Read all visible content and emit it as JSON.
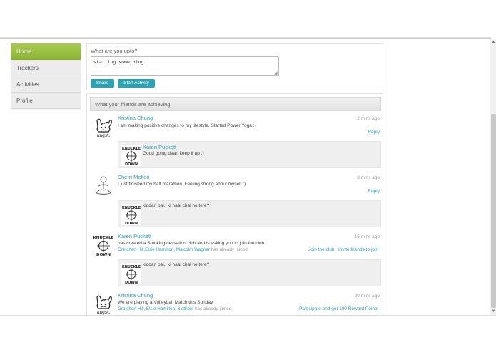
{
  "sidebar": {
    "items": [
      {
        "label": "Home",
        "active": true
      },
      {
        "label": "Trackers",
        "active": false
      },
      {
        "label": "Activities",
        "active": false
      },
      {
        "label": "Profile",
        "active": false
      }
    ]
  },
  "composer": {
    "label": "What are you upto?",
    "input_value": "starting something",
    "share_label": "Share",
    "start_activity_label": "Start Activity"
  },
  "feed": {
    "title": "What your friends are achieving",
    "posts": [
      {
        "name": "Kristina Chung",
        "time": "2 mins ago",
        "text": "I am making positive changes to my lifestyle. Started Power Yoga :)",
        "avatar": "angst-bunny-avatar",
        "action": "Reply",
        "comment": {
          "name": "Karen Puckett",
          "text": "Good going dear, keep it up :)",
          "avatar": "knuckle-down-avatar"
        }
      },
      {
        "name": "Sherri Melton",
        "time": "8 mins ago",
        "text": "I just finished my half marathon. Feeling strong about myself :)",
        "avatar": "meditating-figure-avatar",
        "action": "Reply",
        "comment": {
          "text": "kiddan bai.. ki haal chal ne tere?",
          "avatar": "knuckle-down-avatar"
        }
      },
      {
        "name": "Karen Puckett",
        "time": "15 mins ago",
        "text_before": "has created a ",
        "text_highlight": "Smoking cessation club",
        "text_after": " and is asking you to join the club.",
        "friends_links": "Gretchen Hill,Elsie Hamilton, Malcolm Wagner",
        "friends_suffix": " has already joined.",
        "action_1": "Join the club",
        "action_2": "Invite friends to join",
        "avatar": "knuckle-down-avatar",
        "comment": {
          "text": "kiddan bai.. ki haal chal ne tere?",
          "avatar": "knuckle-down-avatar"
        }
      },
      {
        "name": "Kristina Chung",
        "time": "20 mins ago",
        "text": "We are playing a Volleyball Match this Sunday",
        "friends_links": "Gretchen Hill, Elsie Hamilton, 3 others",
        "friends_suffix": " has already joined.",
        "action": "Participate and get 100 Reward Points",
        "avatar": "angst-bunny-avatar"
      }
    ]
  },
  "colors": {
    "accent": "#2aa4b4",
    "nav_active": "#9bc045",
    "link": "#2a9fb1"
  }
}
